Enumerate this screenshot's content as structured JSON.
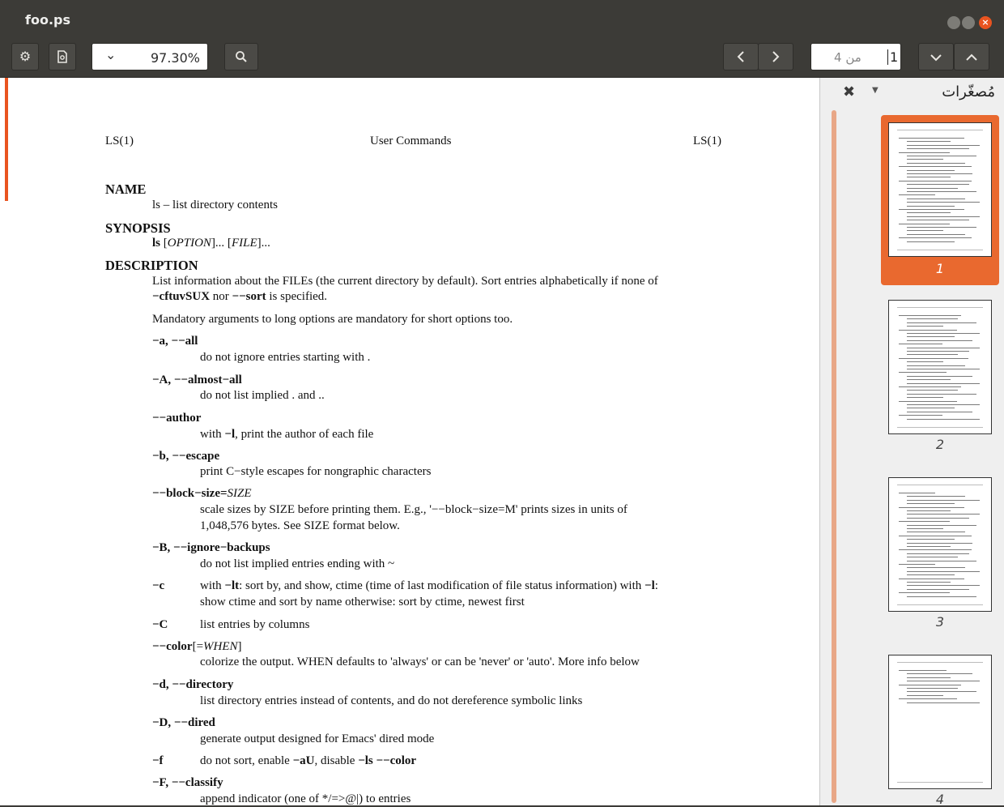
{
  "window": {
    "title": "foo.ps"
  },
  "toolbar": {
    "zoom_value": "97.30%",
    "page_total_label": "من 4",
    "page_current": "1"
  },
  "sidebar": {
    "label": "مُصغّرات",
    "thumbnails": [
      {
        "number": "1",
        "selected": true
      },
      {
        "number": "2",
        "selected": false
      },
      {
        "number": "3",
        "selected": false
      },
      {
        "number": "4",
        "selected": false
      }
    ]
  },
  "document": {
    "header_left": "LS(1)",
    "header_center": "User Commands",
    "header_right": "LS(1)",
    "name_heading": "NAME",
    "name_text": "ls – list directory contents",
    "synopsis_heading": "SYNOPSIS",
    "synopsis_cmd": "ls",
    "synopsis_open1": " [",
    "synopsis_option": "OPTION",
    "synopsis_mid": "]... [",
    "synopsis_file": "FILE",
    "synopsis_close": "]...",
    "description_heading": "DESCRIPTION",
    "desc_line1": "List information about the FILEs (the current directory by default).  Sort entries alphabetically if none of",
    "desc_line2_bold": "−cftuvSUX",
    "desc_line2_nor": " nor ",
    "desc_line2_bold2": "−−sort",
    "desc_line2_rest": " is specified.",
    "mandatory": "Mandatory arguments to long options are mandatory for short options too.",
    "opt_a": "−a, −−all",
    "opt_a_desc": "do not ignore entries starting with .",
    "opt_A": "−A, −−almost−all",
    "opt_A_desc": "do not list implied . and ..",
    "opt_author": "−−author",
    "opt_author_desc_1": "with ",
    "opt_author_desc_b": "−l",
    "opt_author_desc_2": ", print the author of each file",
    "opt_b": "−b, −−escape",
    "opt_b_desc": "print C−style escapes for nongraphic characters",
    "opt_bs": "−−block−size=",
    "opt_bs_arg": "SIZE",
    "opt_bs_desc1": "scale sizes by SIZE before printing them.  E.g., '−−block−size=M' prints sizes in units of",
    "opt_bs_desc2": "1,048,576 bytes.  See SIZE format below.",
    "opt_B": "−B, −−ignore−backups",
    "opt_B_desc": "do not list implied entries ending with ~",
    "opt_c": "−c",
    "opt_c_desc1_a": "with ",
    "opt_c_desc1_b": "−lt",
    "opt_c_desc1_c": ": sort by, and show, ctime (time of last modification of file status information) with ",
    "opt_c_desc1_d": "−l",
    "opt_c_desc1_e": ":",
    "opt_c_desc2": "show ctime and sort by name otherwise: sort by ctime, newest first",
    "opt_C": "−C",
    "opt_C_desc": "list entries by columns",
    "opt_color": "−−color",
    "opt_color_open": "[=",
    "opt_color_arg": "WHEN",
    "opt_color_close": "]",
    "opt_color_desc": "colorize the output.  WHEN defaults to 'always' or can be 'never' or 'auto'.  More info below",
    "opt_d": "−d, −−directory",
    "opt_d_desc": "list directory entries instead of contents, and do not dereference symbolic links",
    "opt_D": "−D, −−dired",
    "opt_D_desc": "generate output designed for Emacs' dired mode",
    "opt_f": "−f",
    "opt_f_desc_a": "do not sort, enable ",
    "opt_f_desc_b": "−aU",
    "opt_f_desc_c": ", disable ",
    "opt_f_desc_d": "−ls −−color",
    "opt_F": "−F, −−classify",
    "opt_F_desc": "append indicator (one of */=>@|) to entries"
  }
}
